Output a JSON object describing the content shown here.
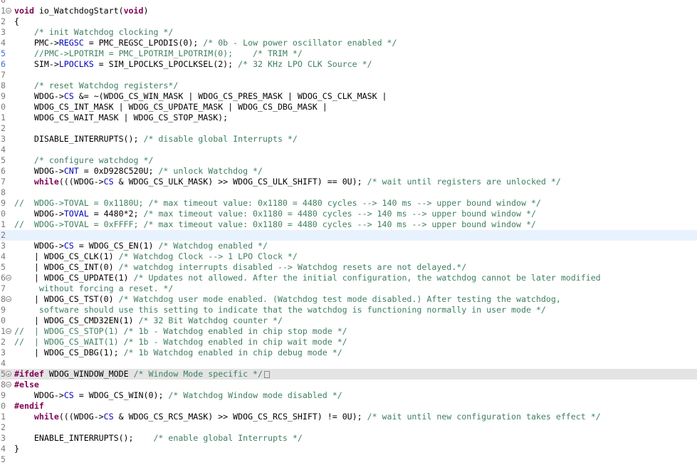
{
  "lines": [
    {
      "num": "0",
      "fold": "",
      "parts": []
    },
    {
      "num": "1",
      "fold": "−",
      "parts": [
        {
          "t": "kw",
          "v": "void"
        },
        {
          "t": "",
          "v": " io_WatchdogStart("
        },
        {
          "t": "kw",
          "v": "void"
        },
        {
          "t": "",
          "v": ")"
        }
      ]
    },
    {
      "num": "2",
      "fold": "",
      "parts": [
        {
          "t": "",
          "v": "{"
        }
      ]
    },
    {
      "num": "3",
      "fold": "",
      "parts": [
        {
          "t": "",
          "v": "    "
        },
        {
          "t": "cm",
          "v": "/* init Watchdog clocking */"
        }
      ]
    },
    {
      "num": "4",
      "fold": "",
      "parts": [
        {
          "t": "",
          "v": "    PMC->"
        },
        {
          "t": "fld",
          "v": "REGSC"
        },
        {
          "t": "",
          "v": " = PMC_REGSC_LPODIS(0); "
        },
        {
          "t": "cm",
          "v": "/* 0b - Low power oscillator enabled */"
        }
      ]
    },
    {
      "num": "5",
      "fold": "",
      "numClass": "chg",
      "parts": [
        {
          "t": "",
          "v": "    "
        },
        {
          "t": "cm",
          "v": "//PMC->LPOTRIM = PMC_LPOTRIM_LPOTRIM(0);    /* TRIM */"
        }
      ]
    },
    {
      "num": "6",
      "fold": "",
      "numClass": "chg",
      "parts": [
        {
          "t": "",
          "v": "    SIM->"
        },
        {
          "t": "fld",
          "v": "LPOCLKS"
        },
        {
          "t": "",
          "v": " = SIM_LPOCLKS_LPOCLKSEL(2); "
        },
        {
          "t": "cm",
          "v": "/* 32 KHz LPO CLK Source */"
        }
      ]
    },
    {
      "num": "7",
      "fold": "",
      "parts": []
    },
    {
      "num": "8",
      "fold": "",
      "parts": [
        {
          "t": "",
          "v": "    "
        },
        {
          "t": "cm",
          "v": "/* reset Watchdog registers*/"
        }
      ]
    },
    {
      "num": "9",
      "fold": "",
      "parts": [
        {
          "t": "",
          "v": "    WDOG->"
        },
        {
          "t": "fld",
          "v": "CS"
        },
        {
          "t": "",
          "v": " &= ~(WDOG_CS_WIN_MASK | WDOG_CS_PRES_MASK | WDOG_CS_CLK_MASK |"
        }
      ]
    },
    {
      "num": "0",
      "fold": "",
      "parts": [
        {
          "t": "",
          "v": "    WDOG_CS_INT_MASK | WDOG_CS_UPDATE_MASK | WDOG_CS_DBG_MASK |"
        }
      ]
    },
    {
      "num": "1",
      "fold": "",
      "parts": [
        {
          "t": "",
          "v": "    WDOG_CS_WAIT_MASK | WDOG_CS_STOP_MASK);"
        }
      ]
    },
    {
      "num": "2",
      "fold": "",
      "parts": []
    },
    {
      "num": "3",
      "fold": "",
      "parts": [
        {
          "t": "",
          "v": "    DISABLE_INTERRUPTS(); "
        },
        {
          "t": "cm",
          "v": "/* disable global Interrupts */"
        }
      ]
    },
    {
      "num": "4",
      "fold": "",
      "parts": []
    },
    {
      "num": "5",
      "fold": "",
      "parts": [
        {
          "t": "",
          "v": "    "
        },
        {
          "t": "cm",
          "v": "/* configure watchdog */"
        }
      ]
    },
    {
      "num": "6",
      "fold": "",
      "parts": [
        {
          "t": "",
          "v": "    WDOG->"
        },
        {
          "t": "fld",
          "v": "CNT"
        },
        {
          "t": "",
          "v": " = 0xD928C520U; "
        },
        {
          "t": "cm",
          "v": "/* unlock Watchdog */"
        }
      ]
    },
    {
      "num": "7",
      "fold": "",
      "parts": [
        {
          "t": "",
          "v": "    "
        },
        {
          "t": "kw",
          "v": "while"
        },
        {
          "t": "",
          "v": "(((WDOG->"
        },
        {
          "t": "fld",
          "v": "CS"
        },
        {
          "t": "",
          "v": " & WDOG_CS_ULK_MASK) >> WDOG_CS_ULK_SHIFT) == 0U); "
        },
        {
          "t": "cm",
          "v": "/* wait until registers are unlocked */"
        }
      ]
    },
    {
      "num": "8",
      "fold": "",
      "parts": []
    },
    {
      "num": "9",
      "fold": "",
      "parts": [
        {
          "t": "cm",
          "v": "//  WDOG->TOVAL = 0x1180U; /* max timeout value: 0x1180 = 4480 cycles --> 140 ms --> upper bound window */"
        }
      ]
    },
    {
      "num": "0",
      "fold": "",
      "parts": [
        {
          "t": "",
          "v": "    WDOG->"
        },
        {
          "t": "fld",
          "v": "TOVAL"
        },
        {
          "t": "",
          "v": " = 4480*2; "
        },
        {
          "t": "cm",
          "v": "/* max timeout value: 0x1180 = 4480 cycles --> 140 ms --> upper bound window */"
        }
      ]
    },
    {
      "num": "1",
      "fold": "",
      "parts": [
        {
          "t": "cm",
          "v": "//  WDOG->TOVAL = 0xFFFF; /* max timeout value: 0x1180 = 4480 cycles --> 140 ms --> upper bound window */"
        }
      ]
    },
    {
      "num": "2",
      "fold": "",
      "current": true,
      "parts": []
    },
    {
      "num": "3",
      "fold": "",
      "parts": [
        {
          "t": "",
          "v": "    WDOG->"
        },
        {
          "t": "fld",
          "v": "CS"
        },
        {
          "t": "",
          "v": " = WDOG_CS_EN(1) "
        },
        {
          "t": "cm",
          "v": "/* Watchdog enabled */"
        }
      ]
    },
    {
      "num": "4",
      "fold": "",
      "parts": [
        {
          "t": "",
          "v": "    | WDOG_CS_CLK(1) "
        },
        {
          "t": "cm",
          "v": "/* Watchdog Clock --> 1 LPO Clock */"
        }
      ]
    },
    {
      "num": "5",
      "fold": "",
      "parts": [
        {
          "t": "",
          "v": "    | WDOG_CS_INT(0) "
        },
        {
          "t": "cm",
          "v": "/* watchdog interrupts disabled --> Watchdog resets are not delayed.*/"
        }
      ]
    },
    {
      "num": "6",
      "fold": "−",
      "parts": [
        {
          "t": "",
          "v": "    | WDOG_CS_UPDATE(1) "
        },
        {
          "t": "cm",
          "v": "/* Updates not allowed. After the initial configuration, the watchdog cannot be later modified"
        }
      ]
    },
    {
      "num": "7",
      "fold": "",
      "parts": [
        {
          "t": "cm",
          "v": "     without forcing a reset. */"
        }
      ]
    },
    {
      "num": "8",
      "fold": "−",
      "parts": [
        {
          "t": "",
          "v": "    | WDOG_CS_TST(0) "
        },
        {
          "t": "cm",
          "v": "/* Watchdog user mode enabled. (Watchdog test mode disabled.) After testing the watchdog,"
        }
      ]
    },
    {
      "num": "9",
      "fold": "",
      "parts": [
        {
          "t": "cm",
          "v": "     software should use this setting to indicate that the watchdog is functioning normally in user mode */"
        }
      ]
    },
    {
      "num": "0",
      "fold": "",
      "parts": [
        {
          "t": "",
          "v": "    | WDOG_CS_CMD32EN(1) "
        },
        {
          "t": "cm",
          "v": "/* 32 Bit Watchdog counter */"
        }
      ]
    },
    {
      "num": "1",
      "fold": "−",
      "parts": [
        {
          "t": "cm",
          "v": "//  | WDOG_CS_STOP(1) /* 1b - Watchdog enabled in chip stop mode */"
        }
      ]
    },
    {
      "num": "2",
      "fold": "",
      "parts": [
        {
          "t": "cm",
          "v": "//  | WDOG_CS_WAIT(1) /* 1b - Watchdog enabled in chip wait mode */"
        }
      ]
    },
    {
      "num": "3",
      "fold": "",
      "parts": [
        {
          "t": "",
          "v": "    | WDOG_CS_DBG(1); "
        },
        {
          "t": "cm",
          "v": "/* 1b Watchdog enabled in chip debug mode */"
        }
      ]
    },
    {
      "num": "4",
      "fold": "",
      "parts": []
    },
    {
      "num": "5",
      "fold": "+",
      "folded": true,
      "parts": [
        {
          "t": "pp",
          "v": "#ifdef"
        },
        {
          "t": "",
          "v": " WDOG_WINDOW_MODE "
        },
        {
          "t": "cm",
          "v": "/* Window Mode specific */"
        },
        {
          "t": "box",
          "v": ""
        }
      ]
    },
    {
      "num": "8",
      "fold": "−",
      "parts": [
        {
          "t": "pp",
          "v": "#else"
        }
      ]
    },
    {
      "num": "9",
      "fold": "",
      "parts": [
        {
          "t": "",
          "v": "    WDOG->"
        },
        {
          "t": "fld",
          "v": "CS"
        },
        {
          "t": "",
          "v": " = WDOG_CS_WIN(0); "
        },
        {
          "t": "cm",
          "v": "/* Watchdog Window mode disabled */"
        }
      ]
    },
    {
      "num": "0",
      "fold": "",
      "parts": [
        {
          "t": "pp",
          "v": "#endif"
        }
      ]
    },
    {
      "num": "1",
      "fold": "",
      "parts": [
        {
          "t": "",
          "v": "    "
        },
        {
          "t": "kw",
          "v": "while"
        },
        {
          "t": "",
          "v": "(((WDOG->"
        },
        {
          "t": "fld",
          "v": "CS"
        },
        {
          "t": "",
          "v": " & WDOG_CS_RCS_MASK) >> WDOG_CS_RCS_SHIFT) != 0U); "
        },
        {
          "t": "cm",
          "v": "/* wait until new configuration takes effect */"
        }
      ]
    },
    {
      "num": "2",
      "fold": "",
      "parts": []
    },
    {
      "num": "3",
      "fold": "",
      "parts": [
        {
          "t": "",
          "v": "    ENABLE_INTERRUPTS();    "
        },
        {
          "t": "cm",
          "v": "/* enable global Interrupts */"
        }
      ]
    },
    {
      "num": "4",
      "fold": "",
      "parts": [
        {
          "t": "",
          "v": "}"
        }
      ]
    },
    {
      "num": "5",
      "fold": "",
      "parts": []
    }
  ]
}
